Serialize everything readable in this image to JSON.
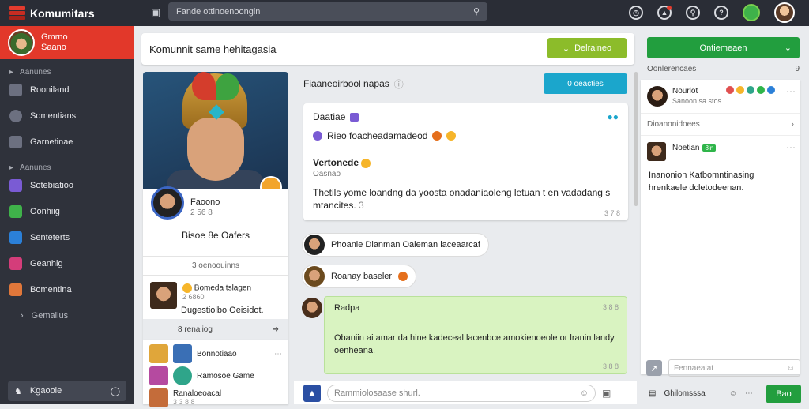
{
  "app": {
    "title": "Komumitars"
  },
  "search": {
    "placeholder": "Fande ottinoenoongin"
  },
  "topbar": {
    "icons": [
      "clock-icon",
      "bell-icon",
      "search-icon",
      "help-icon"
    ]
  },
  "sidebar": {
    "profile": {
      "name": "Gmrno",
      "sub": "Saano"
    },
    "section1": "Aanunes",
    "items1": [
      {
        "label": "Rooniland",
        "icon": "grid-icon"
      },
      {
        "label": "Somentians",
        "icon": "chat-icon"
      },
      {
        "label": "Garnetinae",
        "icon": "gear-icon"
      }
    ],
    "section2": "Aanunes",
    "items2": [
      {
        "label": "Sotebiatioo",
        "color": "#7a5bd4"
      },
      {
        "label": "Oonhiig",
        "color": "#3fb24a"
      },
      {
        "label": "Senteterts",
        "color": "#2b80d8"
      },
      {
        "label": "Geanhig",
        "color": "#d43d7a"
      },
      {
        "label": "Bomentina",
        "color": "#e0773a"
      }
    ],
    "expand_label": "Gemaiius",
    "bottom_label": "Kgaoole"
  },
  "main": {
    "header": "Komunnit same hehitagasia",
    "header_button": "Delraineo"
  },
  "profile_card": {
    "name": "Faoono",
    "stats": "2 56 8",
    "action": "Bisoe 8e Oafers",
    "meta": "3 oenoouinns",
    "mini_title": "Bomeda tslagen",
    "mini_sub": "2 6860",
    "mini_text": "Dugestiolbo Oeisidot.",
    "footer_count": "8 renaiiog",
    "list": [
      {
        "label": "Bonnotiaao"
      },
      {
        "label": "Ramosoe Game"
      },
      {
        "label": "Ranaloeoacal"
      }
    ],
    "list_sub": "3 3 8 8"
  },
  "feed": {
    "title": "Fiaaneoirbool napas",
    "button": "0 oeacties",
    "post": {
      "author": "Daatiae",
      "line1": "Rieo foacheadamadeod",
      "title": "Vertonede",
      "subtitle": "Oasnao",
      "body": "Thetils yome loandng da yoosta onadaniaoleng letuan t en vadadang s mtancites.",
      "count": "3",
      "time": "3 7 8"
    },
    "pills": [
      {
        "text": "Phoanle Dlanman Oaleman laceaarcaf"
      },
      {
        "text": "Roanay baseler"
      }
    ],
    "green_msg": {
      "author": "Radpa",
      "time": "3 8 8",
      "body": "Obaniin ai amar da hine kadeceal lacenbce amokienoeole or lranin landy oenheana.",
      "foot": "3 8 8"
    }
  },
  "composer": {
    "placeholder": "Rammiolosaase shurl."
  },
  "right_panel": {
    "button": "Ontiemeaen",
    "heading": "Oonlerencaes",
    "heading_num": "9",
    "user": {
      "name": "Nourlot",
      "sub": "Sanoon sa stos"
    },
    "link": "Dioanonidoees",
    "message": {
      "name": "Noetian",
      "tag": "8in",
      "body": "Inanonion Katbomntinasing hrenkaele dcletodeenan."
    },
    "compose_placeholder": "Fennaeaiat",
    "footer_label": "Ghilomsssa",
    "send": "Bao"
  }
}
